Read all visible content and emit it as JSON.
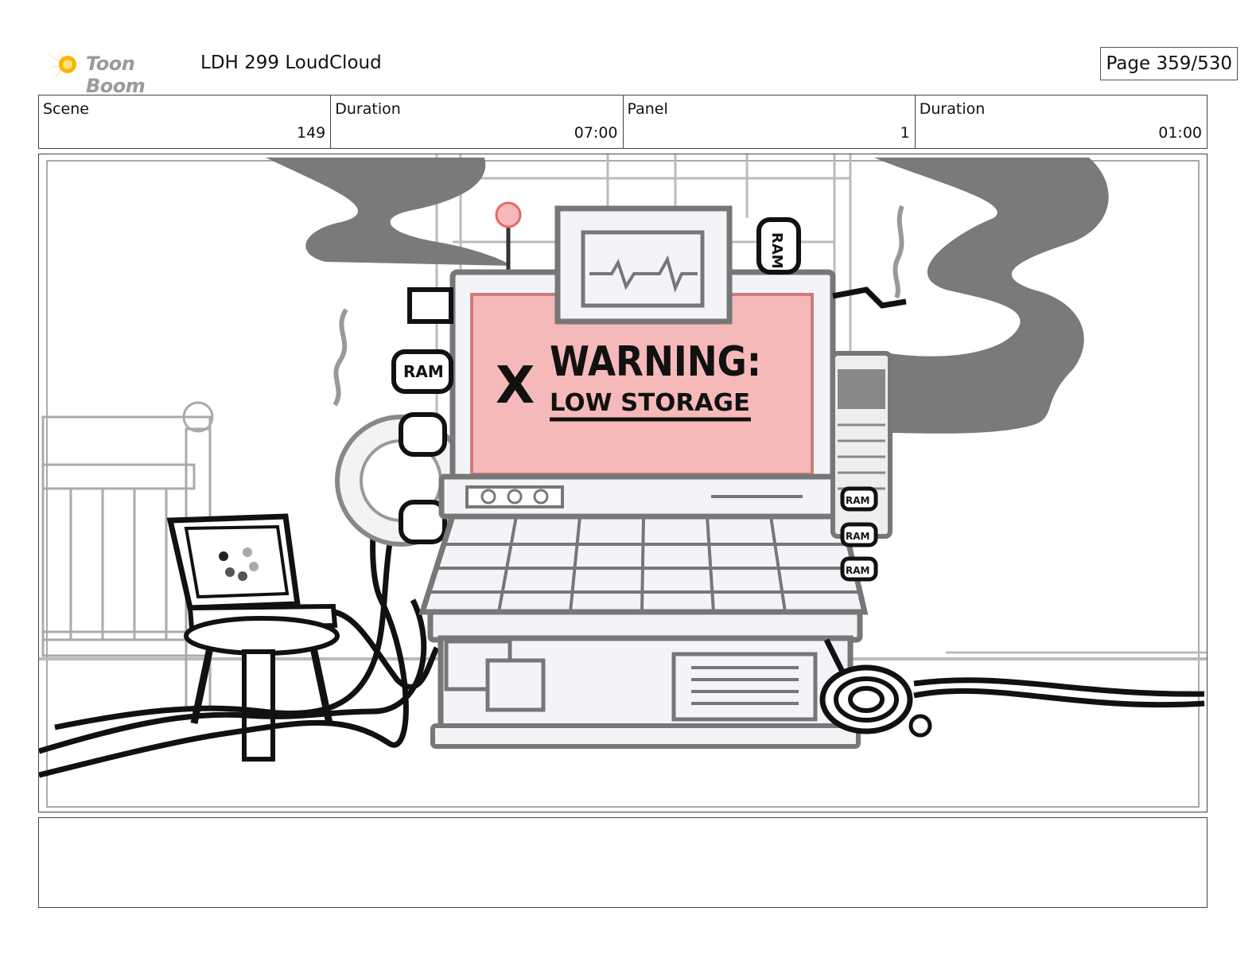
{
  "header": {
    "brand": "Toon Boom",
    "project_title": "LDH 299 LoudCloud",
    "page_label": "Page 359/530"
  },
  "info": {
    "scene_label": "Scene",
    "scene_value": "149",
    "scene_duration_label": "Duration",
    "scene_duration_value": "07:00",
    "panel_label": "Panel",
    "panel_value": "1",
    "panel_duration_label": "Duration",
    "panel_duration_value": "01:00"
  },
  "drawing": {
    "warning_title": "WARNING:",
    "warning_subtitle": "LOW STORAGE",
    "warning_mark": "X",
    "ram_label": "RAM",
    "screen_color": "#f6b9b9",
    "smoke_color": "#7a7a7a"
  },
  "notes": {
    "text": ""
  }
}
